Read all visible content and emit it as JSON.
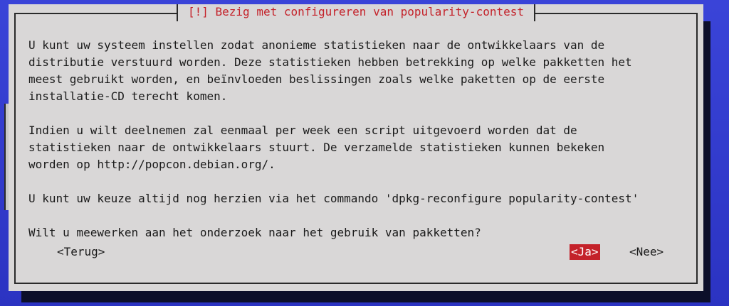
{
  "dialog": {
    "title": "[!] Bezig met configureren van popularity-contest",
    "paragraphs": [
      "U kunt uw systeem instellen zodat anonieme statistieken naar de ontwikkelaars van de\ndistributie verstuurd worden. Deze statistieken hebben betrekking op welke pakketten het\nmeest gebruikt worden, en beïnvloeden beslissingen zoals welke paketten op de eerste\ninstallatie-CD terecht komen.",
      "Indien u wilt deelnemen zal eenmaal per week een script uitgevoerd worden dat de\nstatistieken naar de ontwikkelaars stuurt. De verzamelde statistieken kunnen bekeken\nworden op http://popcon.debian.org/.",
      "U kunt uw keuze altijd nog herzien via het commando 'dpkg-reconfigure popularity-contest'",
      "Wilt u meewerken aan het onderzoek naar het gebruik van pakketten?"
    ],
    "buttons": {
      "back": "<Terug>",
      "yes": "<Ja>",
      "no": "<Nee>"
    }
  },
  "colors": {
    "background": "#2b35c8",
    "dialog": "#d9d7d7",
    "title": "#c4222a",
    "selected_button": "#c4222a"
  }
}
